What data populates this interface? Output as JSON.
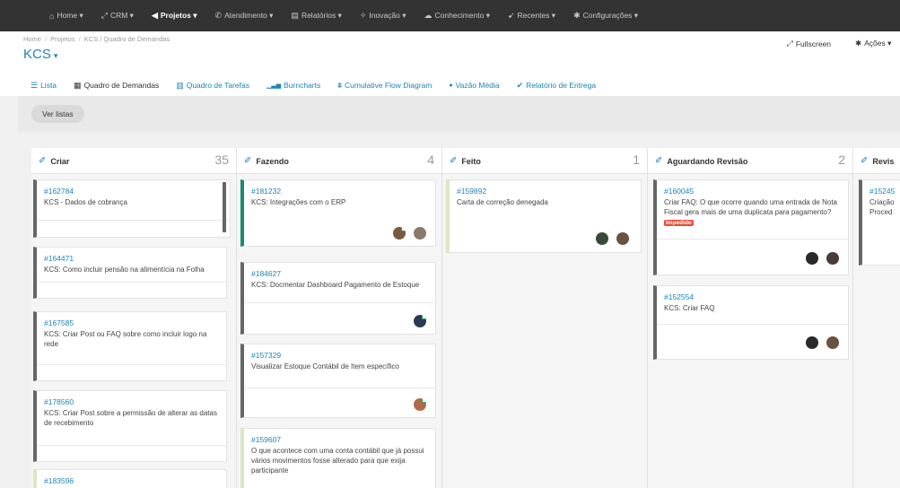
{
  "nav": [
    {
      "icon": "⌂",
      "label": "Home ▾"
    },
    {
      "icon": "⤢",
      "label": "CRM ▾"
    },
    {
      "icon": "◀",
      "label": "Projetos ▾"
    },
    {
      "icon": "✆",
      "label": "Atendimento ▾"
    },
    {
      "icon": "▤",
      "label": "Relatórios ▾"
    },
    {
      "icon": "✧",
      "label": "Inovação ▾"
    },
    {
      "icon": "☁",
      "label": "Conhecimento ▾"
    },
    {
      "icon": "➹",
      "label": "Recentes ▾"
    },
    {
      "icon": "✱",
      "label": "Configurações ▾"
    }
  ],
  "breadcrumb": {
    "home": "Home",
    "projetos": "Projetos",
    "current": "KCS / Quadro de Demandas"
  },
  "title": "KCS",
  "header_actions": {
    "fullscreen": "Fullscreen",
    "acoes": "Ações ▾"
  },
  "tabs": [
    {
      "icon": "☰",
      "label": "Lista"
    },
    {
      "icon": "▦",
      "label": "Quadro de Demandas"
    },
    {
      "icon": "▥",
      "label": "Quadro de Tarefas"
    },
    {
      "icon": "▁▃▅",
      "label": "Burncharts"
    },
    {
      "icon": "⩩",
      "label": "Cumulative Flow Diagram"
    },
    {
      "icon": "●",
      "label": "Vazão Média"
    },
    {
      "icon": "✔",
      "label": "Relatório de Entrega"
    }
  ],
  "ver_listas": "Ver listas",
  "columns": [
    {
      "title": "Criar",
      "count": "35",
      "cards": [
        {
          "id": "#162784",
          "text": "KCS - Dados de cobrança",
          "color": "#666666"
        },
        {
          "id": "#164471",
          "text": "KCS: Como incluir pensão na alimentícia na Folha",
          "color": "#666666"
        },
        {
          "id": "#167585",
          "text": "KCS: Criar Post ou FAQ sobre como incluir logo na rede",
          "color": "#666666"
        },
        {
          "id": "#178560",
          "text": "KCS: Criar Post sobre a permissão de alterar as datas de recebimento",
          "color": "#666666"
        },
        {
          "id": "#183596",
          "text": "",
          "color": "#dbe8c2"
        }
      ]
    },
    {
      "title": "Fazendo",
      "count": "4",
      "cards": [
        {
          "id": "#181232",
          "text": "KCS: Integrações com o ERP",
          "color": "#1a8a72"
        },
        {
          "id": "#184627",
          "text": "KCS: Docmentar Dashboard Pagamento de Estoque",
          "color": "#666666"
        },
        {
          "id": "#157329",
          "text": "Visualizar Estoque Contábil de Item específico",
          "color": "#666666"
        },
        {
          "id": "#159607",
          "text": "O que acontece com uma conta contábil que já possui vários movimentos fosse alterado para que exija participante",
          "color": "#dbe8c2"
        }
      ]
    },
    {
      "title": "Feito",
      "count": "1",
      "cards": [
        {
          "id": "#159892",
          "text": "Carta de correção denegada",
          "color": "#dbe8c2"
        }
      ]
    },
    {
      "title": "Aguardando Revisão",
      "count": "2",
      "cards": [
        {
          "id": "#160045",
          "text": "Criar FAQ: O que ocorre quando uma entrada de Nota Fiscal gera mais de uma duplicata para pagamento?",
          "badge": "Impedido",
          "color": "#666666"
        },
        {
          "id": "#152554",
          "text": "KCS: Criar FAQ",
          "color": "#666666"
        }
      ]
    },
    {
      "title": "Revis",
      "count": "",
      "cards": [
        {
          "id": "#15245",
          "text": "Criação Proced",
          "color": "#666666"
        }
      ]
    }
  ]
}
